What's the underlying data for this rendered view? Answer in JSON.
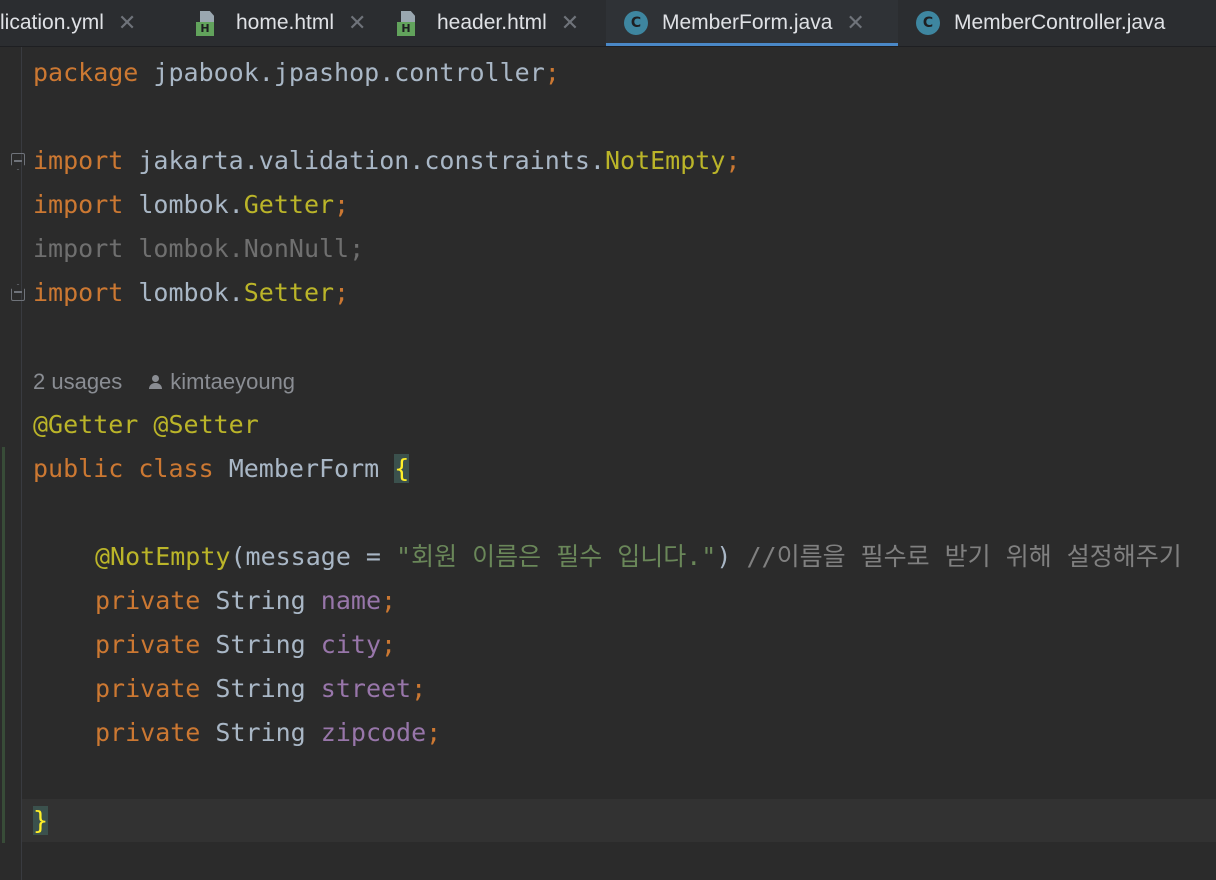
{
  "tabs": [
    {
      "label": "lication.yml",
      "icon": "yml-file-icon",
      "active": false
    },
    {
      "label": "home.html",
      "icon": "html-file-icon",
      "active": false
    },
    {
      "label": "header.html",
      "icon": "html-file-icon",
      "active": false
    },
    {
      "label": "MemberForm.java",
      "icon": "java-class-icon",
      "active": true
    },
    {
      "label": "MemberController.java",
      "icon": "java-class-icon",
      "active": false
    }
  ],
  "tab_close_glyph": "✕",
  "icon_badges": {
    "html": "H",
    "class": "C"
  },
  "colors": {
    "keyword": "#cc7832",
    "annotation": "#bbb529",
    "field": "#9876aa",
    "string": "#6a8759",
    "comment": "#808080",
    "text": "#a9b7c6",
    "active_tab_underline": "#4a88c7"
  },
  "code": {
    "package_kw": "package",
    "package_name": "jpabook.jpashop.controller",
    "semicolon": ";",
    "import_kw": "import",
    "imports": [
      {
        "prefix": "jakarta.validation.constraints.",
        "name": "NotEmpty",
        "unused": false
      },
      {
        "prefix": "lombok.",
        "name": "Getter",
        "unused": false
      },
      {
        "prefix": "lombok.",
        "name": "NonNull",
        "unused": true
      },
      {
        "prefix": "lombok.",
        "name": "Setter",
        "unused": false
      }
    ],
    "usages_hint": "2 usages",
    "author_hint": "kimtaeyoung",
    "class_annotations": "@Getter @Setter",
    "public_kw": "public",
    "class_kw": "class",
    "class_name": "MemberForm",
    "open_brace": "{",
    "close_brace": "}",
    "field_annotation": "@NotEmpty",
    "annotation_open": "(message = ",
    "annotation_message": "\"회원 이름은 필수 입니다.\"",
    "annotation_close": ") ",
    "line_comment": "//이름을 필수로 받기 위해 설정해주기",
    "private_kw": "private",
    "field_type": "String",
    "fields": [
      "name",
      "city",
      "street",
      "zipcode"
    ]
  }
}
